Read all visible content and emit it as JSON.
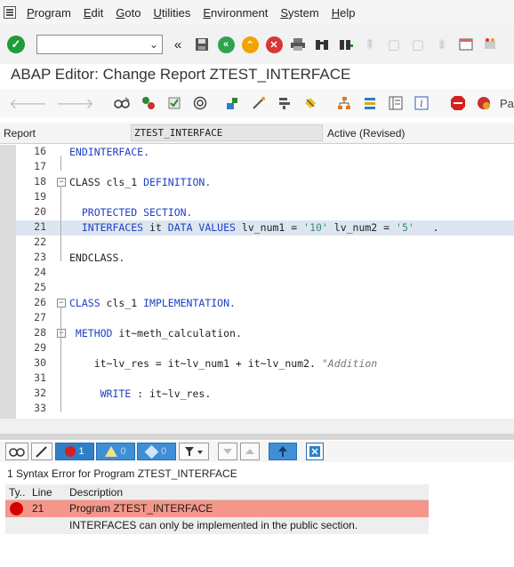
{
  "menubar": {
    "items": [
      {
        "underline": "P",
        "rest": "rogram"
      },
      {
        "underline": "E",
        "rest": "dit"
      },
      {
        "underline": "G",
        "rest": "oto"
      },
      {
        "underline": "U",
        "rest": "tilities"
      },
      {
        "underline": "E",
        "rest": "nvironment"
      },
      {
        "underline": "S",
        "rest": "ystem"
      },
      {
        "underline": "H",
        "rest": "elp"
      }
    ]
  },
  "toolbar": {
    "command_field_value": ""
  },
  "title": "ABAP Editor: Change Report ZTEST_INTERFACE",
  "app_toolbar": {
    "pattern_label": "Pa"
  },
  "report": {
    "label": "Report",
    "name": "ZTEST_INTERFACE",
    "status": "Active (Revised)"
  },
  "editor": {
    "lines": [
      {
        "no": "16",
        "code": [
          [
            "kw",
            "ENDINTERFACE."
          ]
        ]
      },
      {
        "no": "17",
        "code": []
      },
      {
        "no": "18",
        "code": [
          [
            "plain",
            "CLASS cls_1 "
          ],
          [
            "kw",
            "DEFINITION."
          ]
        ]
      },
      {
        "no": "19",
        "code": []
      },
      {
        "no": "20",
        "code": [
          [
            "kw",
            "  PROTECTED SECTION."
          ]
        ]
      },
      {
        "no": "21",
        "code": [
          [
            "kw",
            "  INTERFACES "
          ],
          [
            "plain",
            "it "
          ],
          [
            "kw",
            "DATA VALUES "
          ],
          [
            "plain",
            "lv_num1 = "
          ],
          [
            "str",
            "'10' "
          ],
          [
            "plain",
            "lv_num2 = "
          ],
          [
            "str",
            "'5'  "
          ],
          [
            "plain",
            " ."
          ]
        ]
      },
      {
        "no": "22",
        "code": []
      },
      {
        "no": "23",
        "code": [
          [
            "plain",
            "ENDCLASS."
          ]
        ]
      },
      {
        "no": "24",
        "code": []
      },
      {
        "no": "25",
        "code": []
      },
      {
        "no": "26",
        "code": [
          [
            "kw",
            "CLASS "
          ],
          [
            "plain",
            "cls_1 "
          ],
          [
            "kw",
            "IMPLEMENTATION."
          ]
        ]
      },
      {
        "no": "27",
        "code": []
      },
      {
        "no": "28",
        "code": [
          [
            "kw",
            " METHOD "
          ],
          [
            "plain",
            "it~meth_calculation."
          ]
        ]
      },
      {
        "no": "29",
        "code": []
      },
      {
        "no": "30",
        "code": [
          [
            "plain",
            "    it~lv_res = it~lv_num1 + it~lv_num2. "
          ],
          [
            "cmt",
            "\"Addition"
          ]
        ]
      },
      {
        "no": "31",
        "code": []
      },
      {
        "no": "32",
        "code": [
          [
            "kw",
            "     WRITE "
          ],
          [
            "plain",
            ": it~lv_res."
          ]
        ]
      },
      {
        "no": "33",
        "code": []
      }
    ]
  },
  "messages": {
    "error_count": "1",
    "warning_count": "0",
    "info_count": "0",
    "title": "1 Syntax Error for Program ZTEST_INTERFACE",
    "headers": {
      "type": "Ty..",
      "line": "Line",
      "description": "Description"
    },
    "rows": [
      {
        "line": "21",
        "description": "Program ZTEST_INTERFACE"
      },
      {
        "line": "",
        "description": "INTERFACES can only be implemented in the public section."
      }
    ]
  }
}
